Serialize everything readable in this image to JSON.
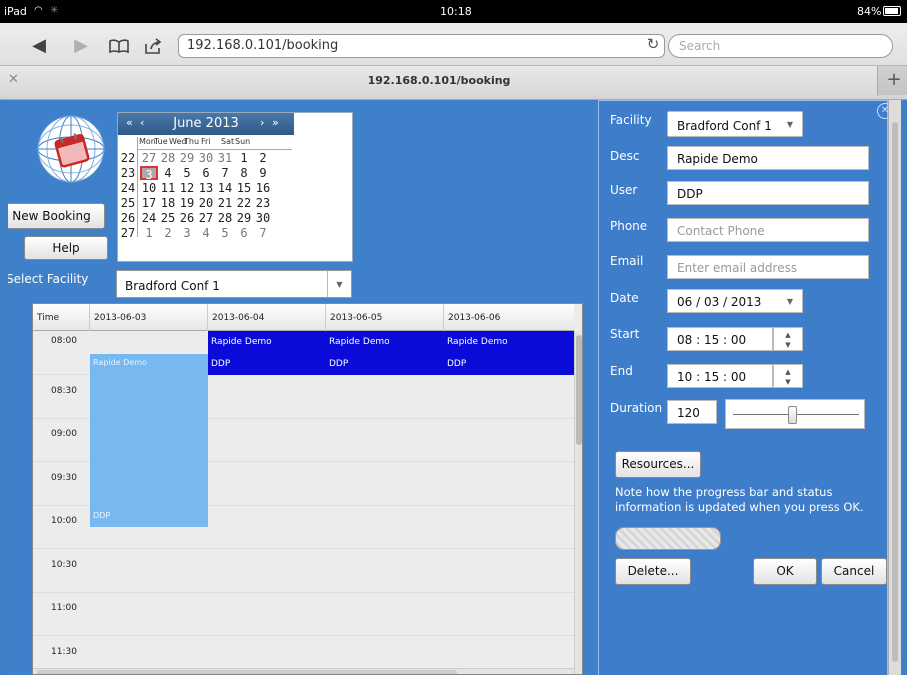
{
  "status": {
    "device": "iPad",
    "time": "10:18",
    "battery": "84%"
  },
  "browser": {
    "url": "192.168.0.101/booking",
    "search_placeholder": "Search",
    "tab_title": "192.168.0.101/booking"
  },
  "calendar": {
    "month_title": "June 2013",
    "nav": {
      "prev_year": "«",
      "prev_month": "‹",
      "next_month": "›",
      "next_year": "»"
    },
    "weekdays": [
      "Mon",
      "Tue",
      "Wed",
      "Thu",
      "Fri",
      "Sat",
      "Sun"
    ],
    "weeks": [
      {
        "num": "22",
        "days": [
          "27",
          "28",
          "29",
          "30",
          "31",
          "1",
          "2"
        ]
      },
      {
        "num": "23",
        "days": [
          "3",
          "4",
          "5",
          "6",
          "7",
          "8",
          "9"
        ]
      },
      {
        "num": "24",
        "days": [
          "10",
          "11",
          "12",
          "13",
          "14",
          "15",
          "16"
        ]
      },
      {
        "num": "25",
        "days": [
          "17",
          "18",
          "19",
          "20",
          "21",
          "22",
          "23"
        ]
      },
      {
        "num": "26",
        "days": [
          "24",
          "25",
          "26",
          "27",
          "28",
          "29",
          "30"
        ]
      },
      {
        "num": "27",
        "days": [
          "1",
          "2",
          "3",
          "4",
          "5",
          "6",
          "7"
        ]
      }
    ],
    "selected_day": "3"
  },
  "buttons": {
    "new_booking": "New Booking",
    "help": "Help"
  },
  "facility_selector": {
    "label": "Select Facility",
    "value": "Bradford Conf 1"
  },
  "schedule": {
    "header_time": "Time",
    "dates": [
      "2013-06-03",
      "2013-06-04",
      "2013-06-05",
      "2013-06-06"
    ],
    "times": [
      "08:00",
      "08:30",
      "09:00",
      "09:30",
      "10:00",
      "10:30",
      "11:00",
      "11:30"
    ],
    "blue_events": [
      {
        "title": "Rapide Demo",
        "user": "DDP"
      },
      {
        "title": "Rapide Demo",
        "user": "DDP"
      },
      {
        "title": "Rapide Demo",
        "user": "DDP"
      }
    ],
    "light_event": {
      "title": "Rapide Demo",
      "user": "DDP"
    }
  },
  "dialog": {
    "facility_label": "Facility",
    "facility_value": "Bradford Conf 1",
    "desc_label": "Desc",
    "desc_value": "Rapide Demo",
    "user_label": "User",
    "user_value": "DDP",
    "phone_label": "Phone",
    "phone_placeholder": "Contact Phone",
    "email_label": "Email",
    "email_placeholder": "Enter email address",
    "date_label": "Date",
    "date_value": "06 / 03 / 2013",
    "start_label": "Start",
    "start_value": "08 : 15 : 00",
    "end_label": "End",
    "end_value": "10 : 15 : 00",
    "duration_label": "Duration",
    "duration_value": "120",
    "resources_button": "Resources...",
    "note": "Note how the progress bar and status information is updated when you press OK.",
    "delete_button": "Delete...",
    "ok_button": "OK",
    "cancel_button": "Cancel"
  }
}
